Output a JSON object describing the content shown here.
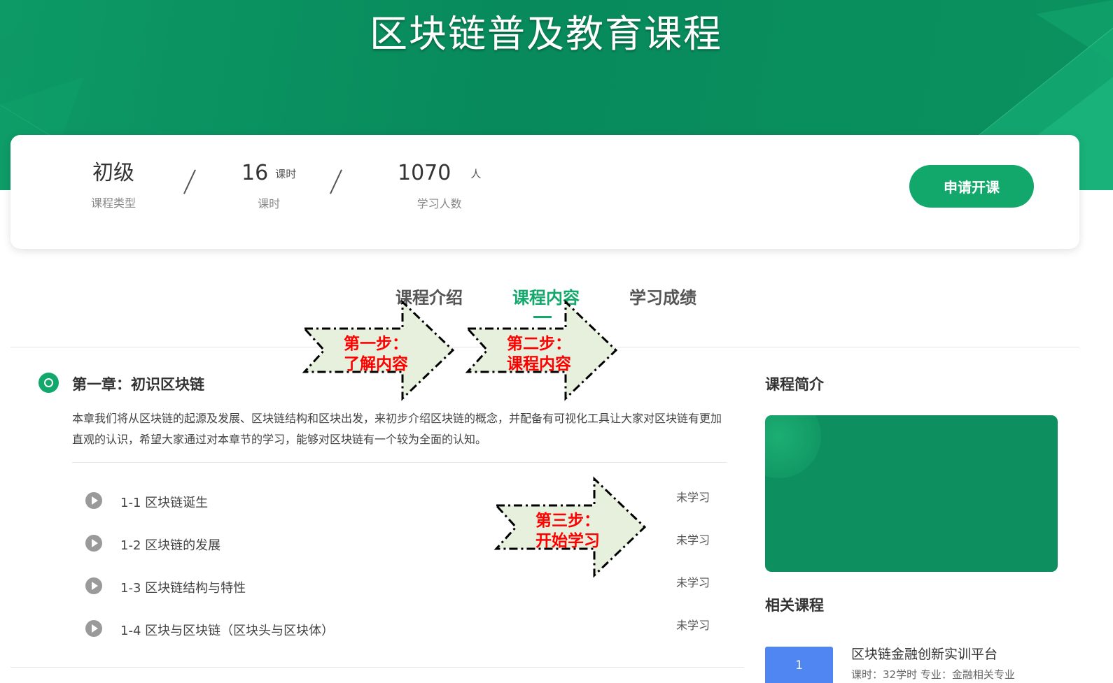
{
  "hero": {
    "title": "区块链普及教育课程"
  },
  "stats": {
    "level": {
      "value": "初级",
      "label": "课程类型"
    },
    "hours": {
      "value": "16",
      "unit": "课时",
      "label": "课时"
    },
    "learners": {
      "value": "1070",
      "unit": "人",
      "label": "学习人数"
    },
    "apply_button": "申请开课"
  },
  "tabs": [
    {
      "label": "课程介绍",
      "active": false
    },
    {
      "label": "课程内容",
      "active": true
    },
    {
      "label": "学习成绩",
      "active": false
    }
  ],
  "chapter": {
    "title": "第一章：初识区块链",
    "description": "本章我们将从区块链的起源及发展、区块链结构和区块出发，来初步介绍区块链的概念，并配备有可视化工具让大家对区块链有更加直观的认识，希望大家通过对本章节的学习，能够对区块链有一个较为全面的认知。",
    "lessons": [
      {
        "title": "1-1 区块链诞生",
        "status": "未学习"
      },
      {
        "title": "1-2 区块链的发展",
        "status": "未学习"
      },
      {
        "title": "1-3 区块链结构与特性",
        "status": "未学习"
      },
      {
        "title": "1-4 区块与区块链（区块头与区块体）",
        "status": "未学习"
      }
    ]
  },
  "callouts": [
    {
      "line1": "第一步：",
      "line2": "了解内容"
    },
    {
      "line1": "第二步：",
      "line2": "课程内容"
    },
    {
      "line1": "第三步：",
      "line2": "开始学习"
    }
  ],
  "sidebar": {
    "intro_heading": "课程简介",
    "related_heading": "相关课程",
    "related": [
      {
        "index": "1",
        "title": "区块链金融创新实训平台",
        "meta": "课时：32学时 专业：金融相关专业"
      }
    ]
  },
  "colors": {
    "brand_green": "#13a86b",
    "callout_fill": "#e6f0dc",
    "callout_text": "#ff0000"
  }
}
